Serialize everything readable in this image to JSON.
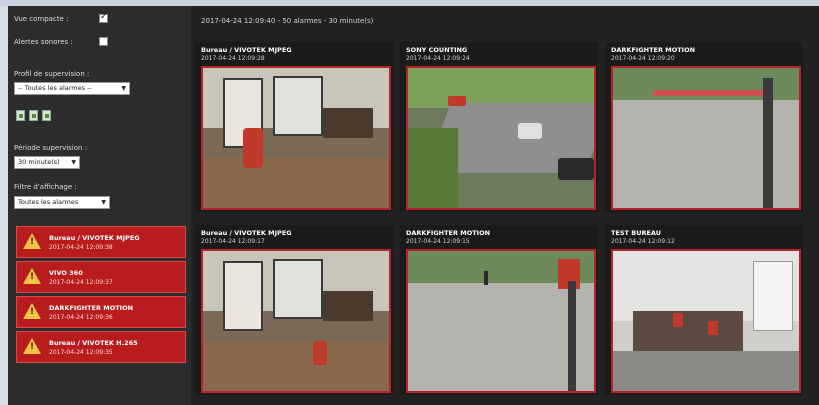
{
  "sidebar": {
    "compact_view_label": "Vue compacte :",
    "compact_view_checked": true,
    "sound_alerts_label": "Alertes sonores :",
    "sound_alerts_checked": false,
    "profile_label": "Profil de supervision :",
    "profile_value": "-- Toutes les alarmes --",
    "period_label": "Période supervision :",
    "period_value": "30 minute(s)",
    "filter_label": "Filtre d'affichage :",
    "filter_value": "Toutes les alarmes",
    "alarms": [
      {
        "title": "Bureau / VIVOTEK MJPEG",
        "time": "2017-04-24 12:09:38"
      },
      {
        "title": "VIVO 360",
        "time": "2017-04-24 12:09:37"
      },
      {
        "title": "DARKFIGHTER MOTION",
        "time": "2017-04-24 12:09:36"
      },
      {
        "title": "Bureau / VIVOTEK H.265",
        "time": "2017-04-24 12:09:35"
      }
    ]
  },
  "main": {
    "status_text": "2017-04-24 12:09:40 - 50 alarmes - 30 minute(s)",
    "cameras": [
      {
        "title": "Bureau / VIVOTEK MJPEG",
        "time": "2017-04-24 12:09:28"
      },
      {
        "title": "SONY COUNTING",
        "time": "2017-04-24 12:09:24"
      },
      {
        "title": "DARKFIGHTER MOTION",
        "time": "2017-04-24 12:09:20"
      },
      {
        "title": "Bureau / VIVOTEK MJPEG",
        "time": "2017-04-24 12:09:17"
      },
      {
        "title": "DARKFIGHTER MOTION",
        "time": "2017-04-24 12:09:15"
      },
      {
        "title": "TEST BUREAU",
        "time": "2017-04-24 12:09:12"
      }
    ]
  },
  "colors": {
    "alarm_red": "#b81c1c",
    "frame_red": "#b8222a",
    "sidebar_bg": "#2c2c2c",
    "main_bg": "#222222",
    "warning_yellow": "#f2c24a"
  },
  "icons": [
    "checkbox-icon",
    "export-icon",
    "warning-icon",
    "dropdown-arrow-icon"
  ]
}
